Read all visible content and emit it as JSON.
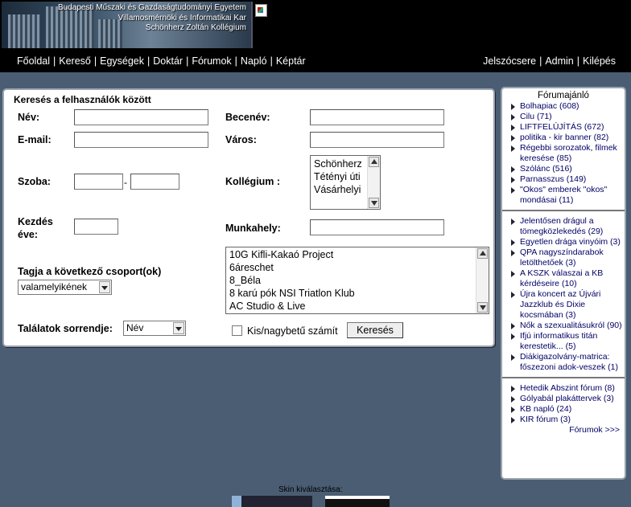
{
  "header": {
    "banner_lines": [
      "Budapesti Műszaki és Gazdaságtudományi Egyetem",
      "Villamosmérnöki és Informatikai Kar",
      "Schönherz Zoltán Kollégium"
    ],
    "nav_left": [
      "Főoldal",
      "Kereső",
      "Egységek",
      "Doktár",
      "Fórumok",
      "Napló",
      "Képtár"
    ],
    "nav_right": [
      "Jelszócsere",
      "Admin",
      "Kilépés"
    ]
  },
  "search": {
    "title": "Keresés a felhasználók között",
    "name_label": "Név:",
    "nickname_label": "Becenév:",
    "email_label": "E-mail:",
    "city_label": "Város:",
    "room_label": "Szoba:",
    "room_dash": "-",
    "dorm_label": "Kollégium :",
    "dorm_options": [
      "Schönherz",
      "Tétényi úti",
      "Vásárhelyi"
    ],
    "start_year_label_1": "Kezdés",
    "start_year_label_2": "éve:",
    "workplace_label": "Munkahely:",
    "group_label": "Tagja a következő csoport(ok)",
    "group_mode_value": "valamelyikének",
    "groups": [
      "10G Kifli-Kakaó Project",
      "6áreschet",
      "8_Béla",
      "8 karú pók NSI Triatlon Klub",
      "AC Studio & Live"
    ],
    "sort_label": "Találatok sorrendje:",
    "sort_value": "Név",
    "case_label": "Kis/nagybetű számít",
    "search_button": "Keresés"
  },
  "sidebar": {
    "title": "Fórumajánló",
    "group1": [
      "Bolhapiac (608)",
      "Cilu (71)",
      "LIFTFELÚJÍTÁS (672)",
      "politika - kir banner (82)",
      "Régebbi sorozatok, filmek keresése (85)",
      "Szólánc (516)",
      "Parnasszus (149)",
      "\"Okos\" emberek \"okos\" mondásai (11)"
    ],
    "group2": [
      "Jelentősen drágul a tömegközlekedés (29)",
      "Egyetlen drága vinyóim (3)",
      "QPA nagyszíndarabok letölthetőek (3)",
      "A KSZK válaszai a KB kérdéseire (10)",
      "Újra koncert az Újvári Jazzklub és Dixie kocsmában (3)",
      "Nők a szexualitásukról (90)",
      "Ifjú informatikus titán kerestetik... (5)",
      "Diákigazolvány-matrica: főszezoni adok-veszek (1)"
    ],
    "group3": [
      "Hetedik Abszint fórum (8)",
      "Gólyabál plakáttervek (3)",
      "KB napló (24)",
      "KIR fórum (3)"
    ],
    "more": "Fórumok >>>"
  },
  "footer": {
    "skin_label": "Skin kiválasztása:"
  }
}
